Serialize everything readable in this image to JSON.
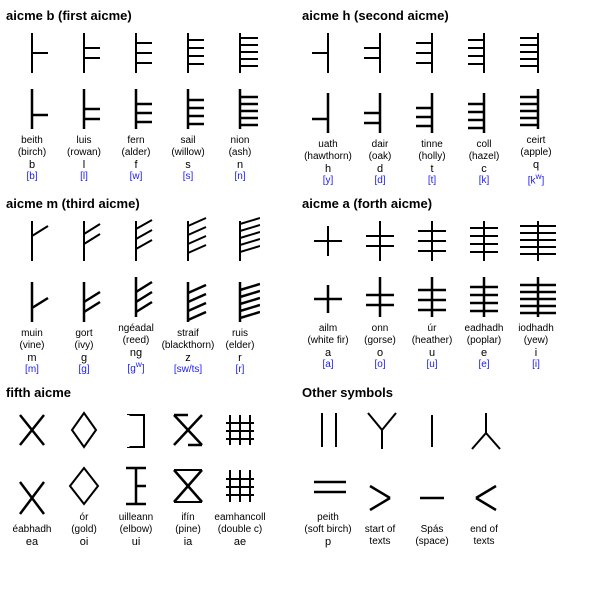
{
  "sections": {
    "aicme_b": {
      "title": "aicme b (first aicme)",
      "letters": [
        {
          "glyph_id": "beith",
          "name": "beith",
          "subtitle": "(birch)",
          "latin": "b",
          "ipa": "[b]"
        },
        {
          "glyph_id": "luis",
          "name": "luis",
          "subtitle": "(rowan)",
          "latin": "l",
          "ipa": "[l]"
        },
        {
          "glyph_id": "fern",
          "name": "fern",
          "subtitle": "(alder)",
          "latin": "f",
          "ipa": "[w]"
        },
        {
          "glyph_id": "sail",
          "name": "sail",
          "subtitle": "(willow)",
          "latin": "s",
          "ipa": "[s]"
        },
        {
          "glyph_id": "nion",
          "name": "nion",
          "subtitle": "(ash)",
          "latin": "n",
          "ipa": "[n]"
        }
      ]
    },
    "aicme_h": {
      "title": "aicme h (second aicme)",
      "letters": [
        {
          "glyph_id": "uath",
          "name": "uath",
          "subtitle": "(hawthorn)",
          "latin": "h",
          "ipa": "[y]"
        },
        {
          "glyph_id": "dair",
          "name": "dair",
          "subtitle": "(oak)",
          "latin": "d",
          "ipa": "[d]"
        },
        {
          "glyph_id": "tinne",
          "name": "tinne",
          "subtitle": "(holly)",
          "latin": "t",
          "ipa": "[t]"
        },
        {
          "glyph_id": "coll",
          "name": "coll",
          "subtitle": "(hazel)",
          "latin": "c",
          "ipa": "[k]"
        },
        {
          "glyph_id": "ceirt",
          "name": "ceirt",
          "subtitle": "(apple)",
          "latin": "q",
          "ipa": "[kw]"
        }
      ]
    },
    "aicme_m": {
      "title": "aicme m (third aicme)",
      "letters": [
        {
          "glyph_id": "muin",
          "name": "muin",
          "subtitle": "(vine)",
          "latin": "m",
          "ipa": "[m]"
        },
        {
          "glyph_id": "gort",
          "name": "gort",
          "subtitle": "(ivy)",
          "latin": "g",
          "ipa": "[g]"
        },
        {
          "glyph_id": "ngeadal",
          "name": "ngéadal",
          "subtitle": "(reed)",
          "latin": "ng",
          "ipa": "[gw]"
        },
        {
          "glyph_id": "straif",
          "name": "straif",
          "subtitle": "(blackthorn)",
          "latin": "z",
          "ipa": "[sw/ts]"
        },
        {
          "glyph_id": "ruis",
          "name": "ruis",
          "subtitle": "(elder)",
          "latin": "r",
          "ipa": "[r]"
        }
      ]
    },
    "aicme_a": {
      "title": "aicme a (forth aicme)",
      "letters": [
        {
          "glyph_id": "ailm",
          "name": "ailm",
          "subtitle": "(white fir)",
          "latin": "a",
          "ipa": "[a]"
        },
        {
          "glyph_id": "onn",
          "name": "onn",
          "subtitle": "(gorse)",
          "latin": "o",
          "ipa": "[o]"
        },
        {
          "glyph_id": "ur",
          "name": "úr",
          "subtitle": "(heather)",
          "latin": "u",
          "ipa": "[u]"
        },
        {
          "glyph_id": "eadhadh",
          "name": "eadhadh",
          "subtitle": "(poplar)",
          "latin": "e",
          "ipa": "[e]"
        },
        {
          "glyph_id": "iodhadh",
          "name": "iodhadh",
          "subtitle": "(yew)",
          "latin": "i",
          "ipa": "[i]"
        }
      ]
    },
    "fifth_aicme": {
      "title": "fifth aicme",
      "letters": [
        {
          "glyph_id": "eabhadh",
          "name": "éabhadh",
          "subtitle": "",
          "latin": "ea",
          "ipa": ""
        },
        {
          "glyph_id": "or",
          "name": "ór",
          "subtitle": "(gold)",
          "latin": "oi",
          "ipa": ""
        },
        {
          "glyph_id": "uilleann",
          "name": "uilleann",
          "subtitle": "(elbow)",
          "latin": "ui",
          "ipa": ""
        },
        {
          "glyph_id": "ifin",
          "name": "ifín",
          "subtitle": "(pine)",
          "latin": "ia",
          "ipa": ""
        },
        {
          "glyph_id": "eamhancoll",
          "name": "eamhancoll",
          "subtitle": "(double c)",
          "latin": "ae",
          "ipa": ""
        }
      ]
    },
    "other_symbols": {
      "title": "Other symbols",
      "letters": [
        {
          "glyph_id": "peith",
          "name": "peith",
          "subtitle": "(soft birch)",
          "latin": "p",
          "ipa": ""
        },
        {
          "glyph_id": "start_texts",
          "name": "start of texts",
          "subtitle": "",
          "latin": "",
          "ipa": ""
        },
        {
          "glyph_id": "spas",
          "name": "Spás",
          "subtitle": "(space)",
          "latin": "",
          "ipa": ""
        },
        {
          "glyph_id": "end_texts",
          "name": "end of texts",
          "subtitle": "",
          "latin": "",
          "ipa": ""
        }
      ]
    }
  }
}
